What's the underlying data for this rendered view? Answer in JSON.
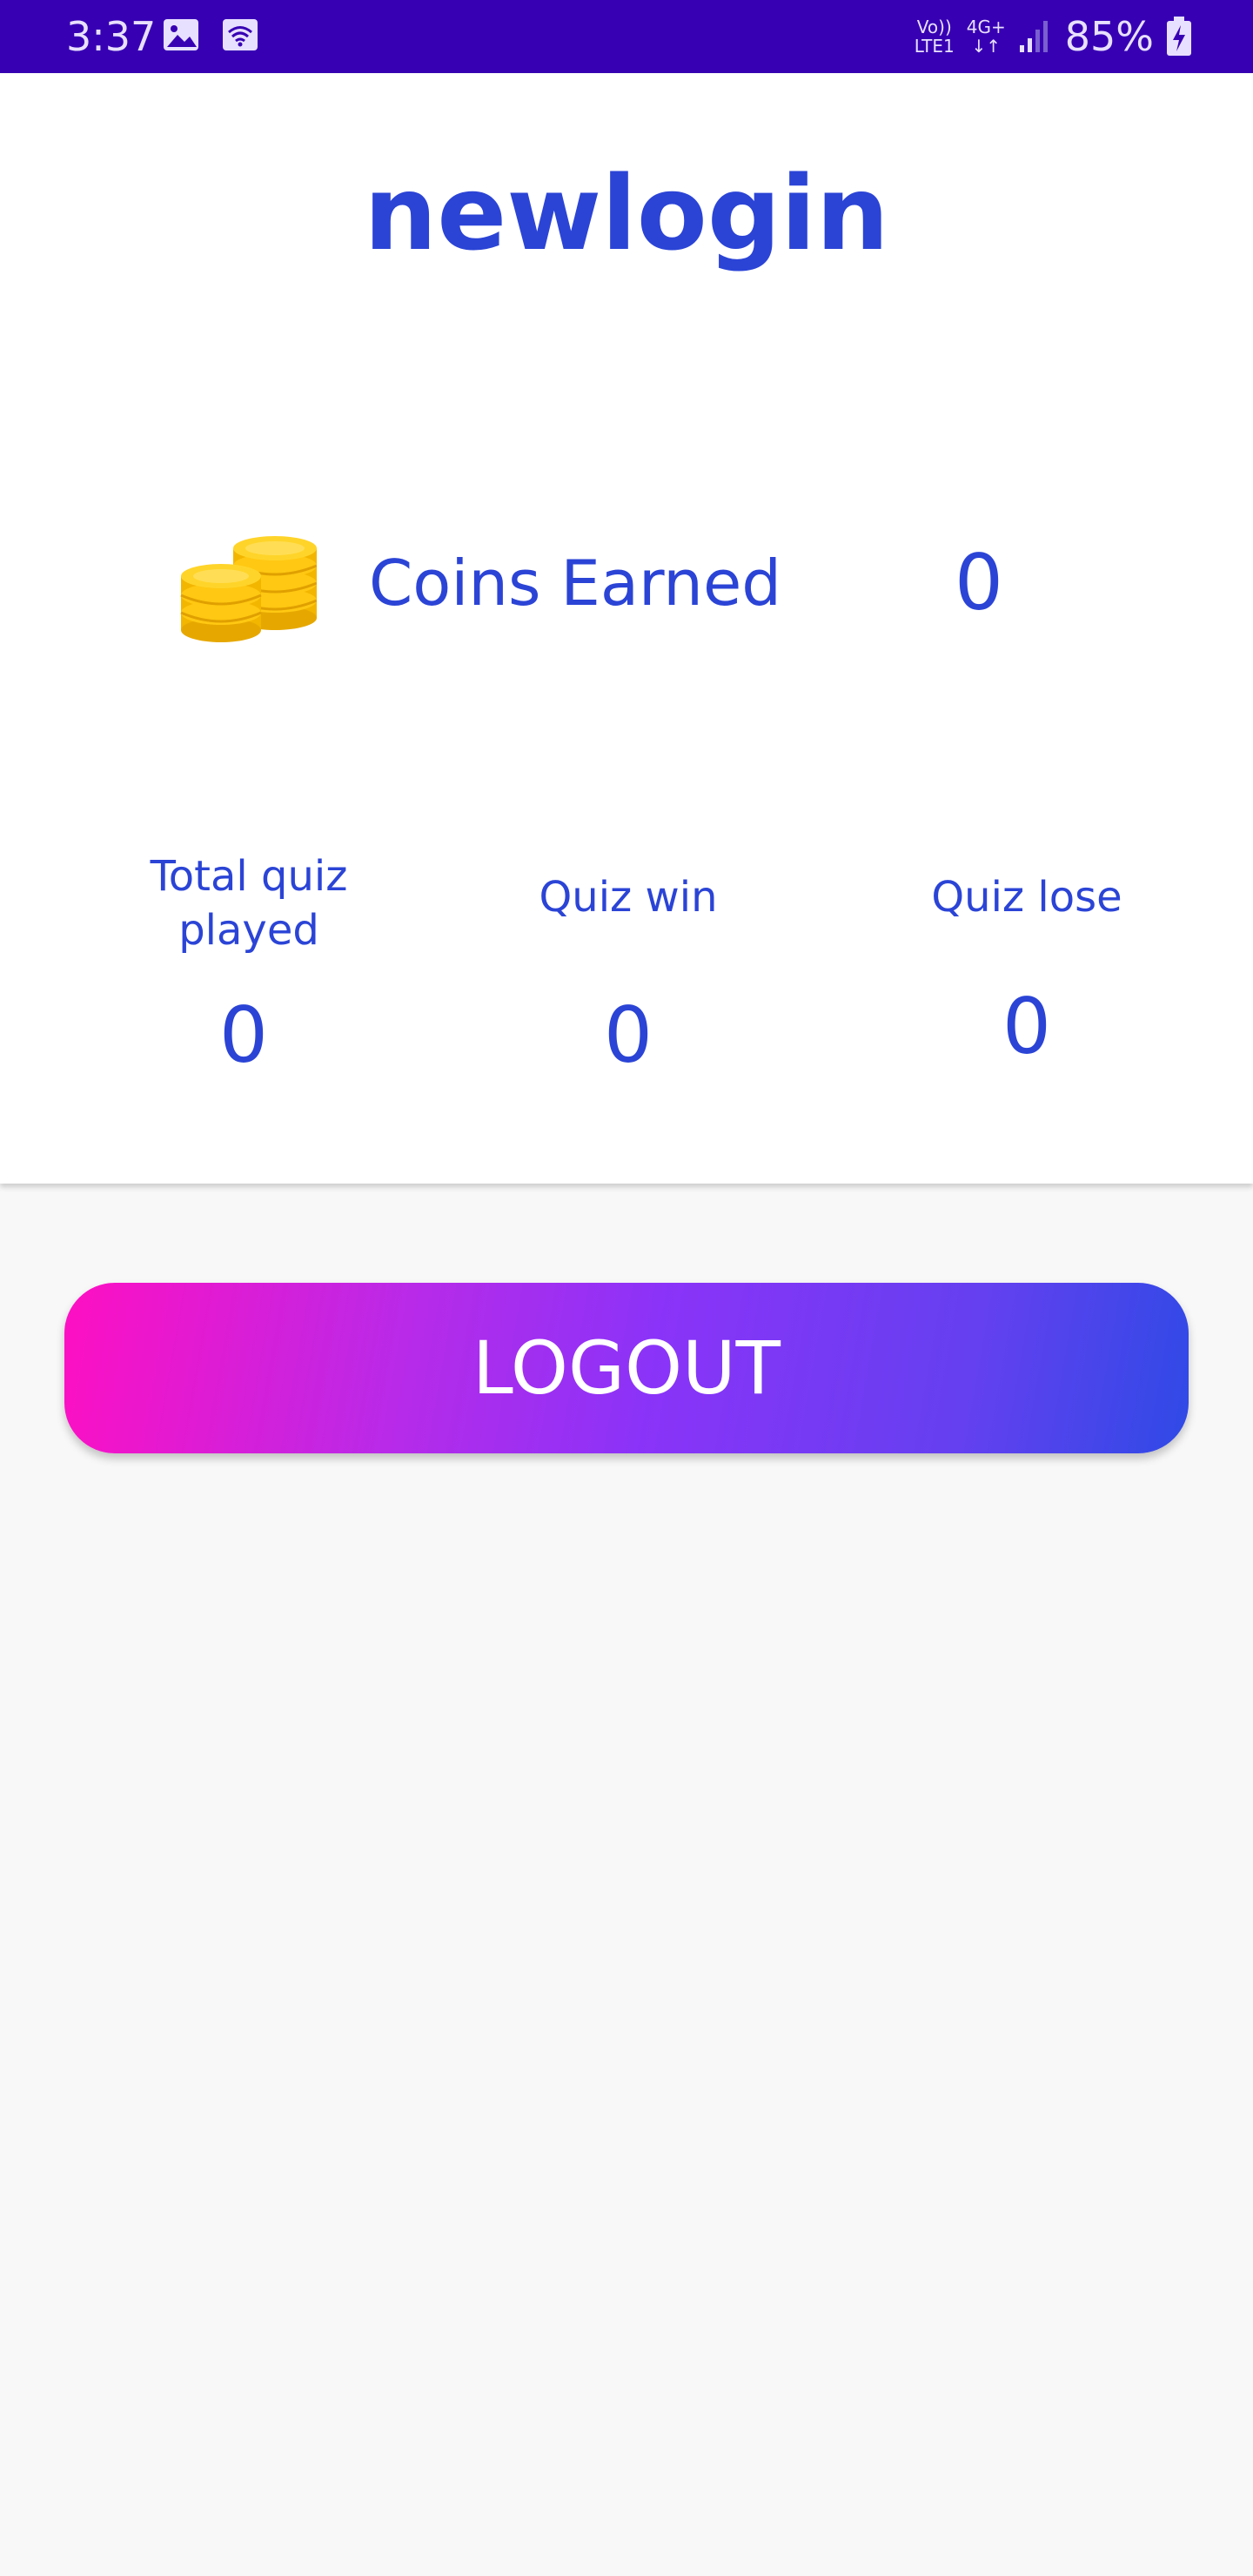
{
  "status_bar": {
    "time": "3:37",
    "network_top": "Vo))",
    "network_bottom": "LTE1",
    "data_type": "4G+",
    "battery": "85%",
    "icons": [
      "image-icon",
      "wifi-icon",
      "signal-icon",
      "battery-charging-icon"
    ],
    "background_color": "#3700b3"
  },
  "profile": {
    "username": "newlogin",
    "coins_label": "Coins Earned",
    "coins_value": "0",
    "coins_icon": "coins-icon"
  },
  "stats": [
    {
      "label": "Total quiz played",
      "value": "0"
    },
    {
      "label": "Quiz win",
      "value": "0"
    },
    {
      "label": "Quiz lose",
      "value": "0"
    }
  ],
  "actions": {
    "logout_label": "LOGOUT"
  },
  "colors": {
    "accent_text": "#2b44d6",
    "gradient_start": "#ff0fc2",
    "gradient_end": "#2f4ae6"
  }
}
